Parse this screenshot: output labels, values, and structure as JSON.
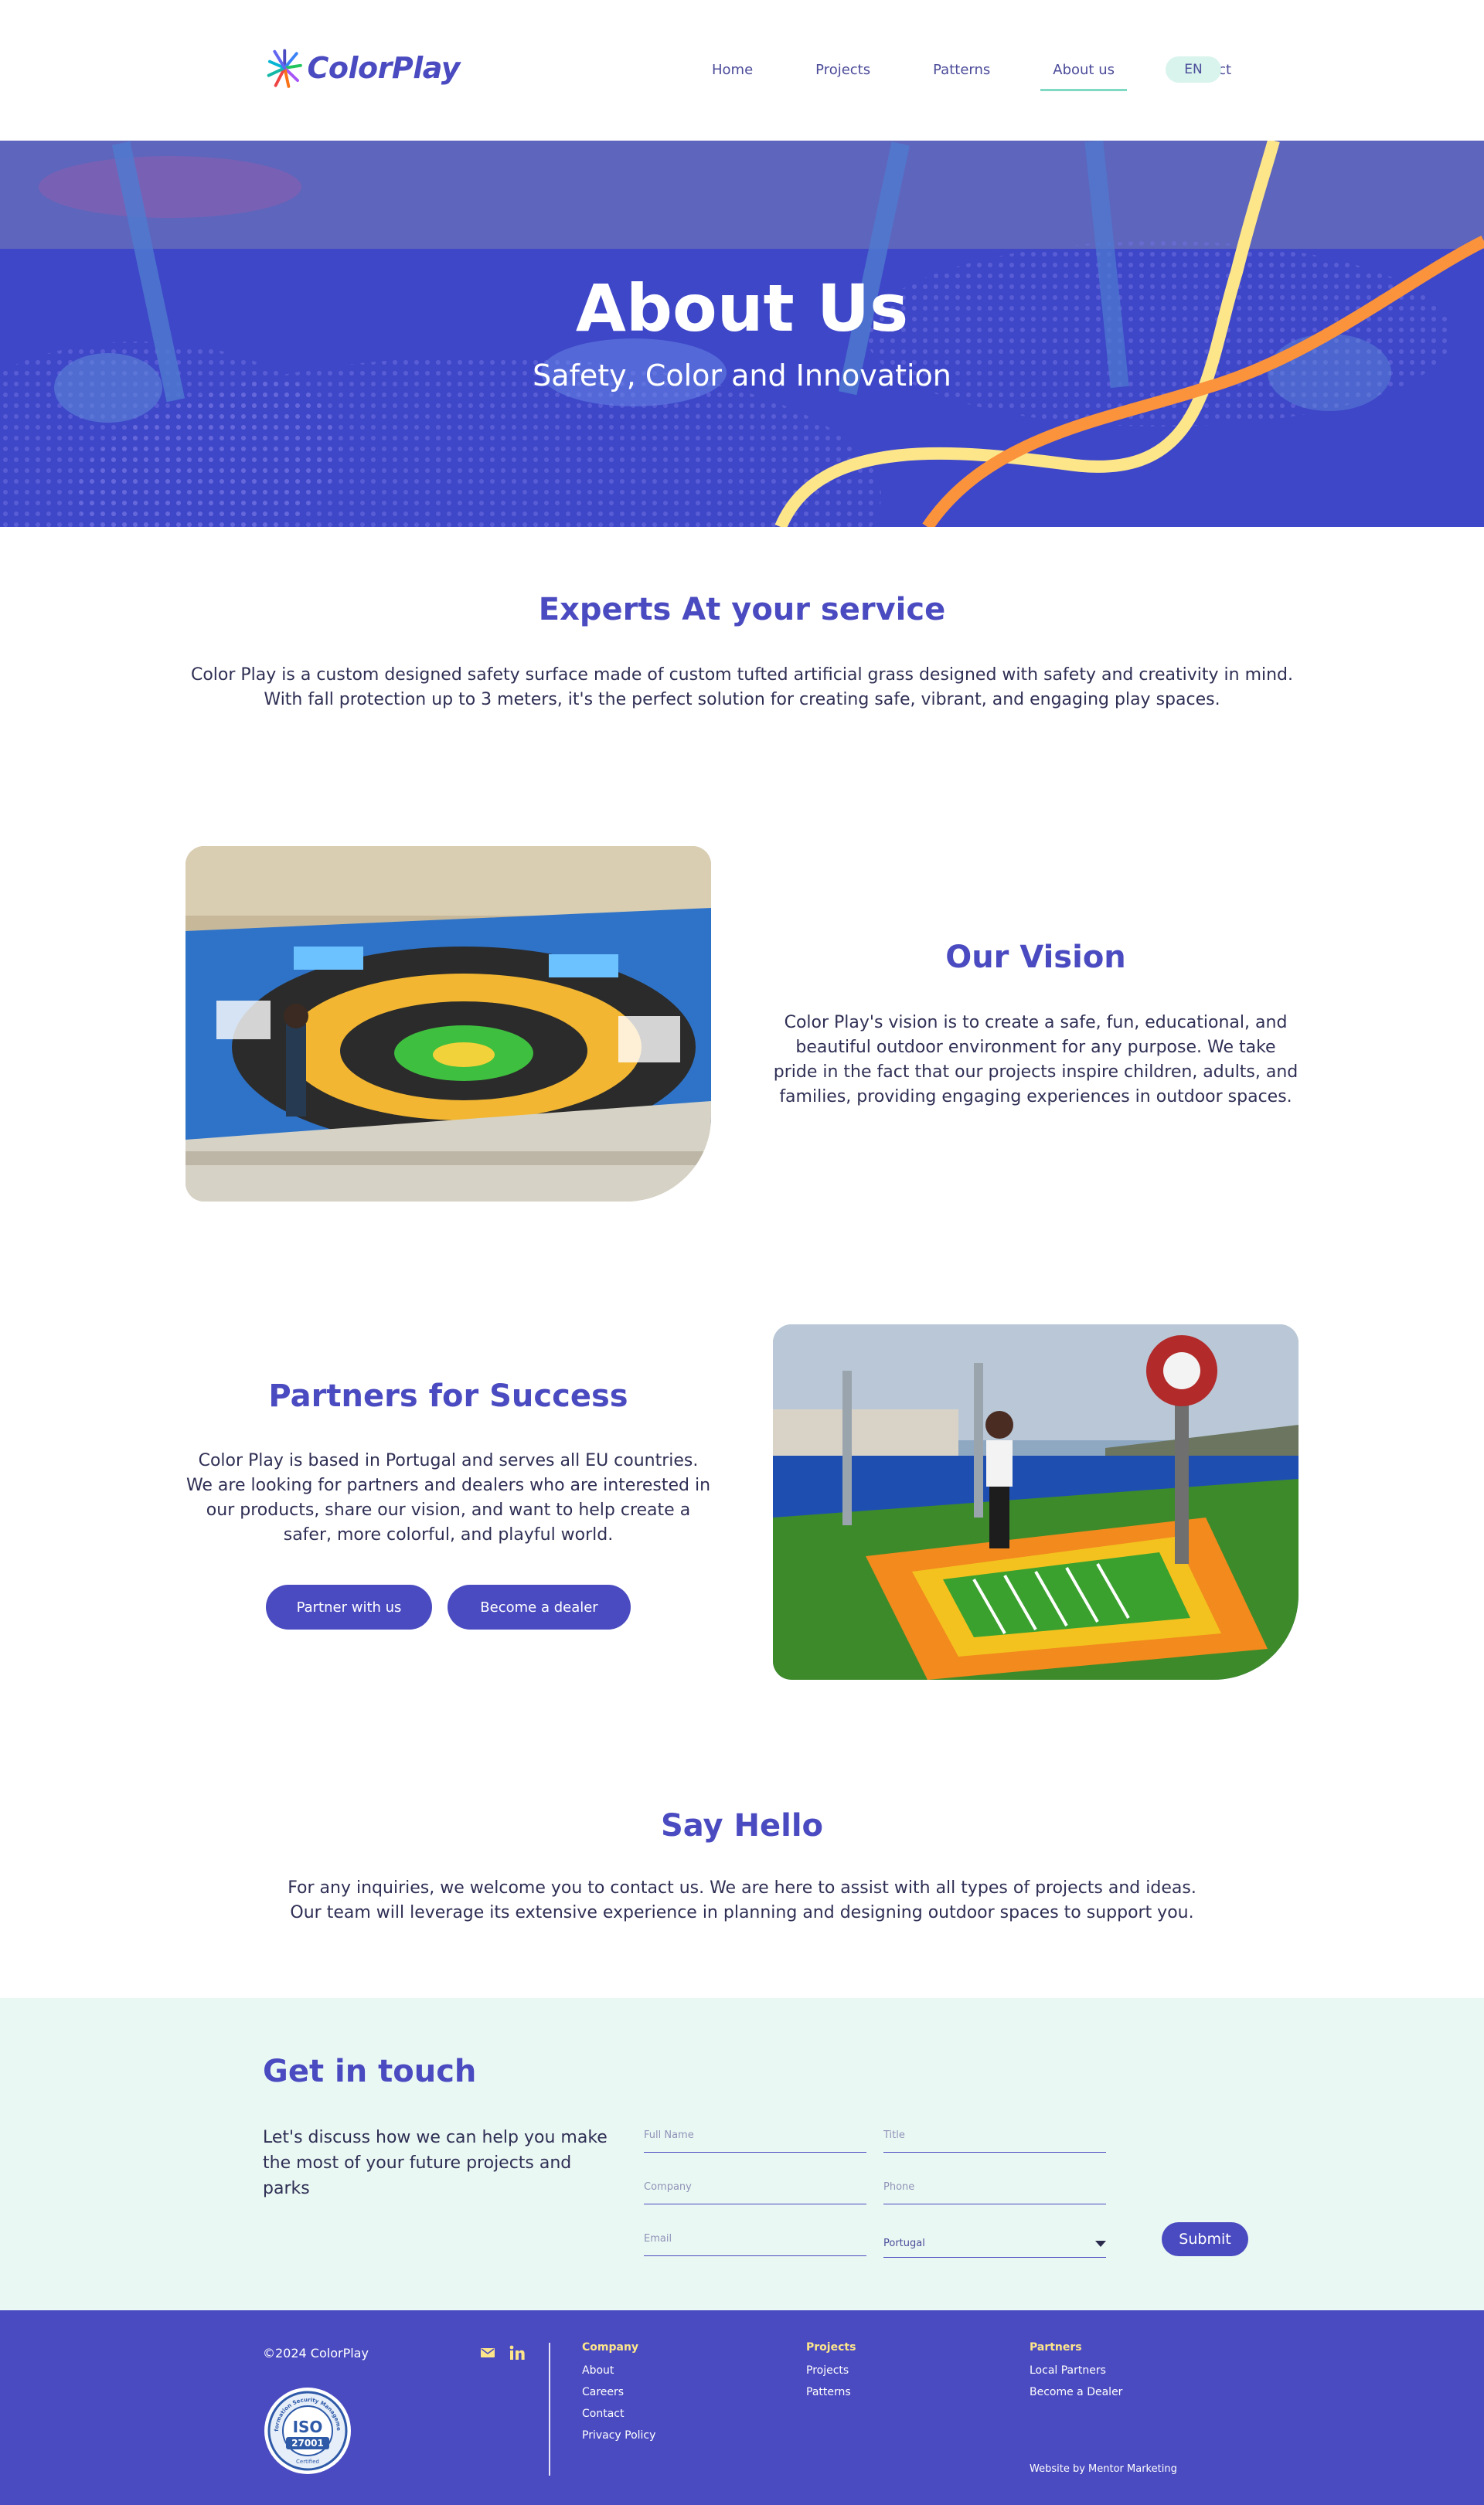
{
  "brand": {
    "name": "ColorPlay",
    "colors": {
      "primary": "#4b4bc1",
      "mint": "#d8f4ec",
      "mint_bg": "#eaf8f3",
      "accent_yellow": "#fde68a",
      "accent_orange": "#fb923c"
    }
  },
  "nav": {
    "items": [
      "Home",
      "Projects",
      "Patterns",
      "About us",
      "Contact"
    ],
    "active": "About us",
    "lang": "EN"
  },
  "hero": {
    "title": "About Us",
    "subtitle": "Safety, Color and Innovation"
  },
  "experts": {
    "title": "Experts At your service",
    "text": "Color Play is a custom designed safety surface made of custom tufted artificial grass designed with safety and creativity in mind. With fall protection up to 3 meters, it's the perfect solution for creating safe, vibrant, and engaging play spaces."
  },
  "vision": {
    "title": "Our Vision",
    "text": "Color Play's vision is to create a safe, fun, educational, and beautiful outdoor environment for any purpose. We take pride in the fact that our projects inspire children, adults, and families, providing engaging experiences in outdoor spaces."
  },
  "partners": {
    "title": "Partners for Success",
    "line1": "Color Play is based in Portugal and serves all EU countries.",
    "line2": "We are looking for partners and dealers who are interested in our products, share our vision, and want to help create a safer, more colorful, and playful world.",
    "btn_partner": "Partner with us",
    "btn_dealer": "Become a dealer"
  },
  "hello": {
    "title": "Say Hello",
    "line1": "For any inquiries, we welcome you to contact us. We are here to assist with all types of projects and ideas.",
    "line2": "Our team will leverage its extensive experience in planning and designing outdoor spaces to support you."
  },
  "contact": {
    "title": "Get in touch",
    "text": "Let's discuss how we can help you make the most of your future projects and parks",
    "fields": {
      "full_name": "Full Name",
      "title": "Title",
      "company": "Company",
      "phone": "Phone",
      "email": "Email"
    },
    "country": "Portugal",
    "submit": "Submit"
  },
  "footer": {
    "copyright": "©2024 ColorPlay",
    "iso": {
      "top": "Information Security Management",
      "main": "ISO",
      "number": "27001",
      "bottom": "Certified"
    },
    "company": {
      "head": "Company",
      "links": [
        "About",
        "Careers",
        "Contact",
        "Privacy Policy"
      ]
    },
    "projects": {
      "head": "Projects",
      "links": [
        "Projects",
        "Patterns"
      ]
    },
    "partners": {
      "head": "Partners",
      "links": [
        "Local Partners",
        "Become a Dealer"
      ]
    },
    "credit_prefix": "Website by",
    "credit_name": "Mentor Marketing"
  }
}
